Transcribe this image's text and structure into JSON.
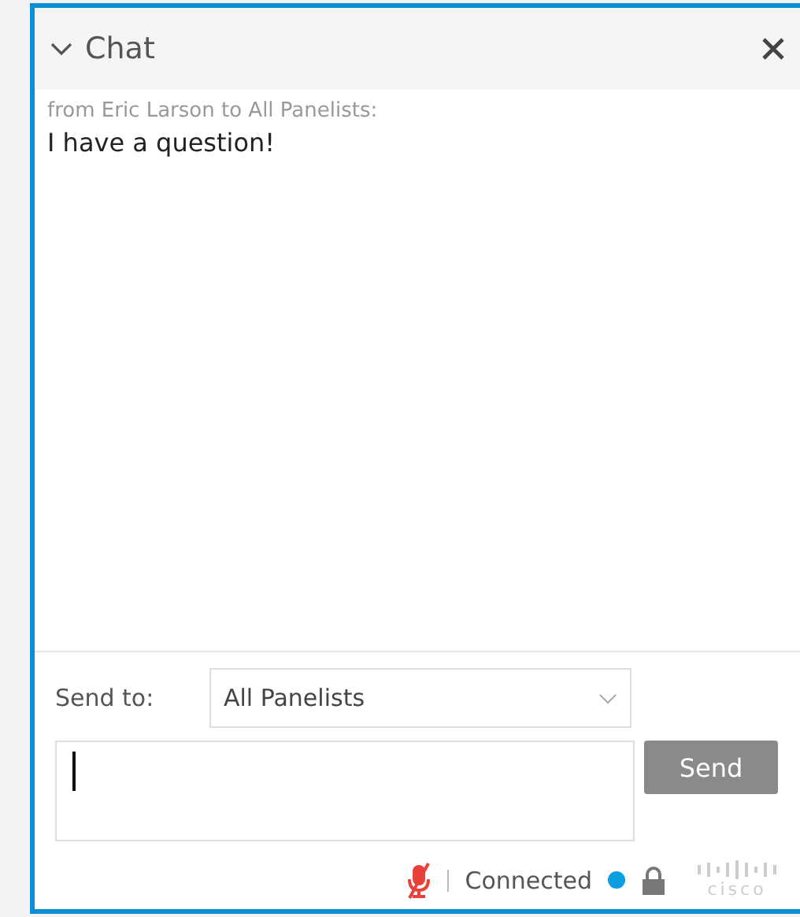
{
  "panel": {
    "title": "Chat",
    "expanded": true
  },
  "messages": [
    {
      "sender": "from Eric Larson to All Panelists:",
      "text": "I have a question!"
    }
  ],
  "send_to": {
    "label": "Send to:",
    "value": "All Panelists"
  },
  "message_input": {
    "focused": true
  },
  "send_button": {
    "label": "Send",
    "disabled": true
  },
  "status_bar": {
    "microphone_muted": true,
    "connection": "Connected",
    "connected": true,
    "logo_text": "cisco"
  }
}
